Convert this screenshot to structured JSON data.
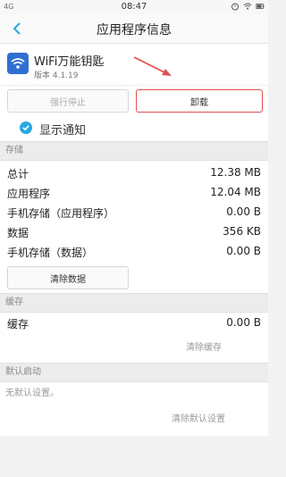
{
  "status_bar": {
    "network": "4G",
    "time": "08:47"
  },
  "header": {
    "title": "应用程序信息"
  },
  "app": {
    "name": "WiFi万能钥匙",
    "version": "版本 4.1.19",
    "icon": "wifi-key-app-icon"
  },
  "actions": {
    "force_stop": "强行停止",
    "uninstall": "卸载"
  },
  "notifications": {
    "label": "显示通知",
    "checked": true
  },
  "storage": {
    "header": "存储",
    "rows": [
      {
        "label": "总计",
        "value": "12.38 MB"
      },
      {
        "label": "应用程序",
        "value": "12.04 MB"
      },
      {
        "label": "手机存储（应用程序）",
        "value": "0.00 B"
      },
      {
        "label": "数据",
        "value": "356 KB"
      },
      {
        "label": "手机存储（数据）",
        "value": "0.00 B"
      }
    ],
    "clear_data": "清除数据"
  },
  "cache": {
    "header": "缓存",
    "label": "缓存",
    "value": "0.00 B",
    "clear_cache": "清除缓存"
  },
  "default_launch": {
    "header": "默认启动",
    "description": "无默认设置。",
    "clear_defaults": "清除默认设置"
  },
  "colors": {
    "accent": "#2aa7e0",
    "highlight": "#e05050"
  }
}
